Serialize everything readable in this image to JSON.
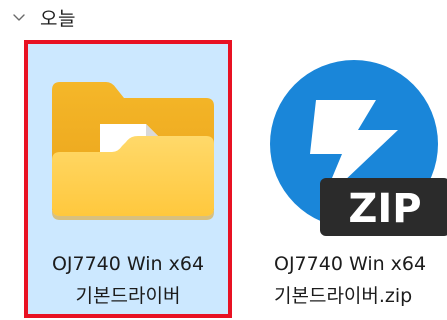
{
  "group": {
    "label": "오늘",
    "chevron_icon": "chevron-down-icon"
  },
  "items": [
    {
      "type": "folder",
      "icon": "folder-icon",
      "name_line1": "OJ7740 Win x64",
      "name_line2": "기본드라이버",
      "selected": true
    },
    {
      "type": "zip",
      "icon": "zip-archive-icon",
      "badge_text": "ZIP",
      "name_line1": "OJ7740 Win x64",
      "name_line2": "기본드라이버.zip",
      "selected": false
    }
  ],
  "colors": {
    "selection_bg": "#cce8ff",
    "highlight_border": "#e81123",
    "folder_yellow": "#ffc83d",
    "zip_blue": "#1a86d9",
    "zip_badge_dark": "#2b2b2b"
  }
}
